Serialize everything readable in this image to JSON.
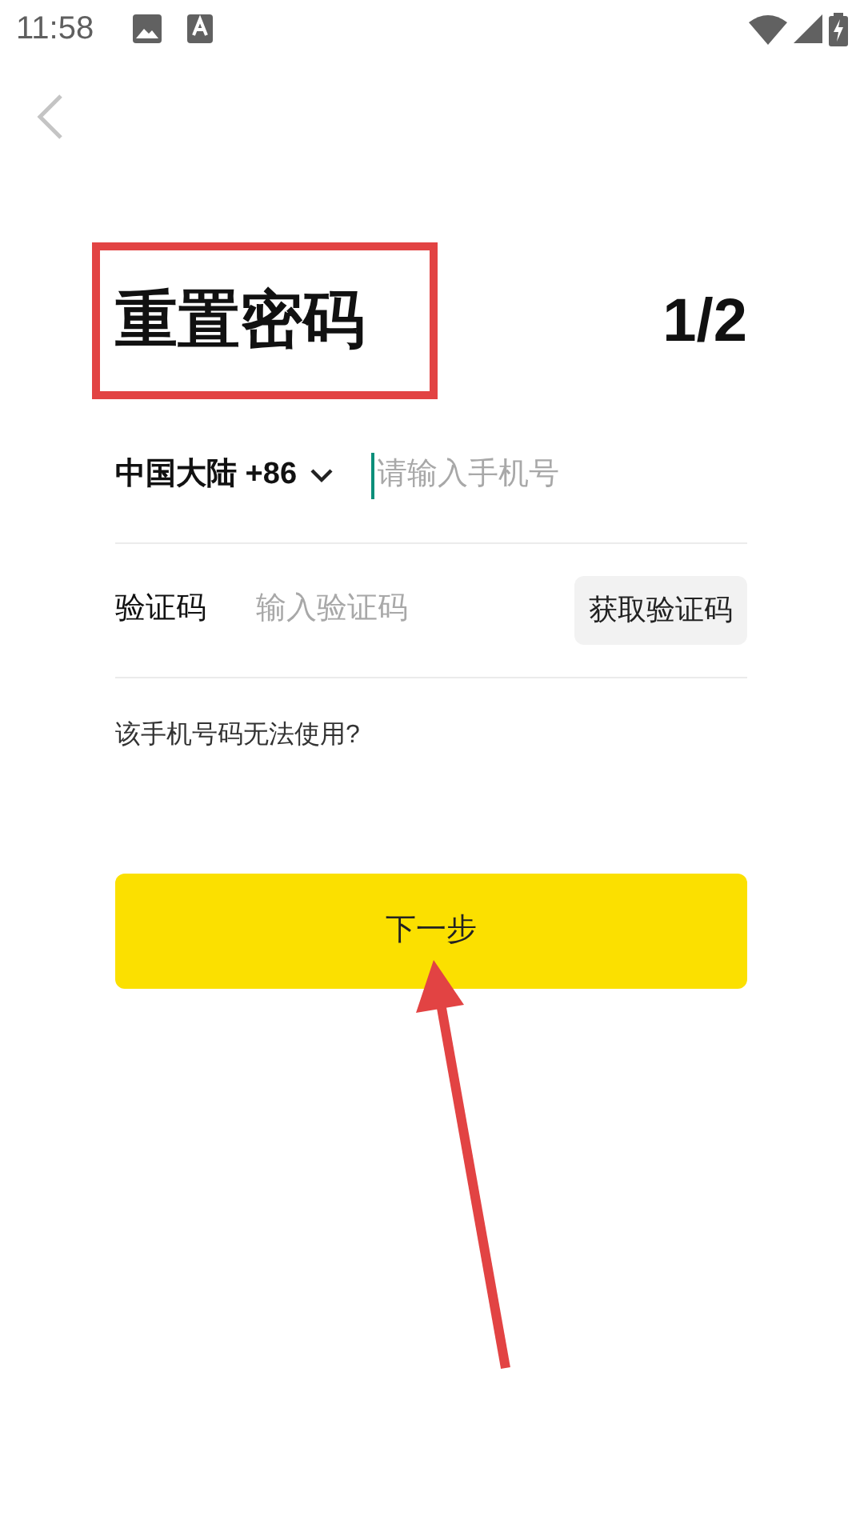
{
  "status_bar": {
    "time": "11:58"
  },
  "title": "重置密码",
  "step": "1/2",
  "phone": {
    "region": "中国大陆 +86",
    "placeholder": "请输入手机号",
    "focused": true
  },
  "code": {
    "label": "验证码",
    "placeholder": "输入验证码",
    "button": "获取验证码"
  },
  "help_link": "该手机号码无法使用?",
  "next_button": "下一步"
}
